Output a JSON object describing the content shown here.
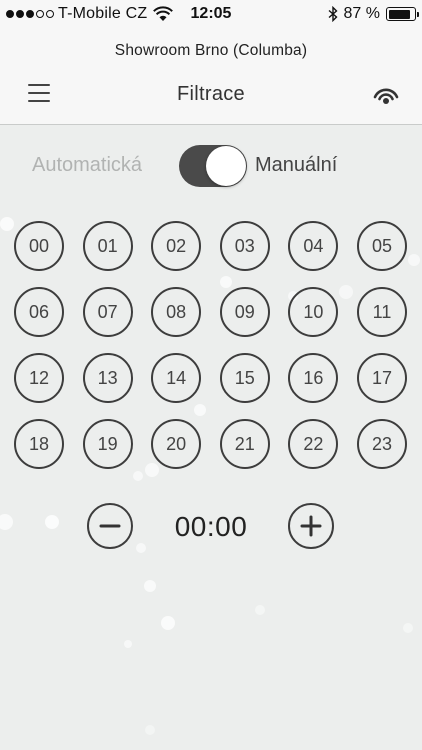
{
  "status_bar": {
    "carrier": "T-Mobile CZ",
    "time": "12:05",
    "battery_text": "87 %",
    "battery_level": 0.87,
    "signal_bars_filled": 3,
    "signal_bars_total": 5
  },
  "header": {
    "location": "Showroom Brno (Columba)",
    "title": "Filtrace"
  },
  "mode": {
    "auto_label": "Automatická",
    "manual_label": "Manuální",
    "selected": "manual"
  },
  "hours": [
    "00",
    "01",
    "02",
    "03",
    "04",
    "05",
    "06",
    "07",
    "08",
    "09",
    "10",
    "11",
    "12",
    "13",
    "14",
    "15",
    "16",
    "17",
    "18",
    "19",
    "20",
    "21",
    "22",
    "23"
  ],
  "timer": {
    "value": "00:00"
  },
  "colors": {
    "background": "#eceeed",
    "header_background": "#f7f7f7",
    "toggle_track": "#4a4a4a",
    "circle_border": "#3d3d3d",
    "muted_text": "#b1b3b2"
  },
  "icons": {
    "menu": "hamburger-menu-icon",
    "signal": "wifi-signal-icon",
    "minus": "minus-icon",
    "plus": "plus-icon",
    "bluetooth": "bluetooth-icon",
    "battery": "battery-icon"
  }
}
